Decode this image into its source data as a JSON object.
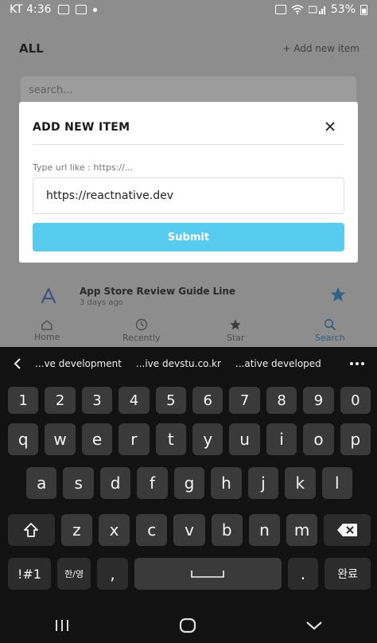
{
  "statusbar": {
    "left_text": "KT 4:36",
    "right_text": "53%"
  },
  "header": {
    "title": "ALL",
    "add_link": "+ Add new item"
  },
  "search": {
    "placeholder": "search..."
  },
  "list_item": {
    "name": "App Store Review Guide Line",
    "date": "3 days ago"
  },
  "tabs": [
    {
      "label": "Home",
      "icon": "home-icon"
    },
    {
      "label": "Recently",
      "icon": "clock-icon"
    },
    {
      "label": "Star",
      "icon": "star-icon"
    },
    {
      "label": "Search",
      "icon": "search-icon",
      "active": true
    }
  ],
  "modal": {
    "title": "ADD NEW ITEM",
    "hint": "Type url like : https://...",
    "input_value": "https://reactnative.dev",
    "submit_label": "Submit"
  },
  "keyboard": {
    "suggestions": [
      "...ve development",
      "...ive devstu.co.kr",
      "...ative developed"
    ],
    "row_num": [
      "1",
      "2",
      "3",
      "4",
      "5",
      "6",
      "7",
      "8",
      "9",
      "0"
    ],
    "row_q": [
      "q",
      "w",
      "e",
      "r",
      "t",
      "y",
      "u",
      "i",
      "o",
      "p"
    ],
    "row_a": [
      "a",
      "s",
      "d",
      "f",
      "g",
      "h",
      "j",
      "k",
      "l"
    ],
    "row_z": [
      "z",
      "x",
      "c",
      "v",
      "b",
      "n",
      "m"
    ],
    "symbols_label": "!#1",
    "lang_label": "한/영",
    "comma": ",",
    "period": ".",
    "done_label": "완료"
  },
  "colors": {
    "accent": "#58ccef",
    "active_tab": "#2d5f7f",
    "star": "#2f6487"
  }
}
